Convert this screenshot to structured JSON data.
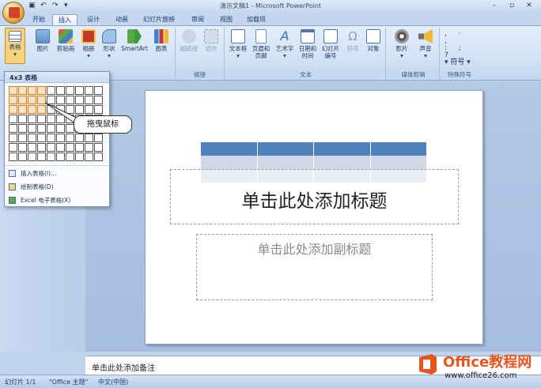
{
  "window": {
    "title": "演示文稿1 - Microsoft PowerPoint"
  },
  "tabs": [
    {
      "label": "开始"
    },
    {
      "label": "插入",
      "active": true
    },
    {
      "label": "设计"
    },
    {
      "label": "动画"
    },
    {
      "label": "幻灯片放映"
    },
    {
      "label": "审阅"
    },
    {
      "label": "视图"
    },
    {
      "label": "加载项"
    }
  ],
  "ribbon": {
    "table": {
      "label": "表格"
    },
    "picture": {
      "label": "图片"
    },
    "clipart": {
      "label": "剪贴画"
    },
    "album": {
      "label": "相册"
    },
    "shapes": {
      "label": "形状"
    },
    "smartart": {
      "label": "SmartArt"
    },
    "chart": {
      "label": "图表"
    },
    "hyperlink": {
      "label": "超链接"
    },
    "action": {
      "label": "动作"
    },
    "links_group": "链接",
    "textbox": {
      "label": "文本框"
    },
    "header_footer": {
      "label1": "页眉和",
      "label2": "页脚"
    },
    "wordart": {
      "label": "艺术字"
    },
    "datetime": {
      "label1": "日期和",
      "label2": "时间"
    },
    "slide_number": {
      "label1": "幻灯片",
      "label2": "编号"
    },
    "symbol": {
      "label": "符号"
    },
    "object": {
      "label": "对象"
    },
    "text_group": "文本",
    "movie": {
      "label": "影片"
    },
    "sound": {
      "label": "声音"
    },
    "media_group": "媒体剪辑",
    "special_symbol": {
      "label": "符号"
    },
    "special_group": "特殊符号"
  },
  "dropdown": {
    "header": "4x3 表格",
    "grid_cols": 10,
    "grid_rows": 8,
    "selected_cols": 4,
    "selected_rows": 3,
    "items": [
      {
        "label": "插入表格(I)..."
      },
      {
        "label": "绘制表格(D)"
      },
      {
        "label": "Excel 电子表格(X)"
      }
    ]
  },
  "callout": {
    "text": "拖曳鼠标"
  },
  "slide": {
    "title_placeholder": "单击此处添加标题",
    "subtitle_placeholder": "单击此处添加副标题"
  },
  "notes": {
    "placeholder": "单击此处添加备注"
  },
  "status": {
    "slide": "幻灯片 1/1",
    "theme": "\"Office 主题\"",
    "language": "中文(中国)"
  },
  "watermark": {
    "brand": "Office教程网",
    "url": "www.office26.com"
  },
  "colors": {
    "accent": "#4f81bd",
    "table_header": "#4f81bd",
    "table_band": "#d0d8e8",
    "selection": "#e07a1b"
  }
}
